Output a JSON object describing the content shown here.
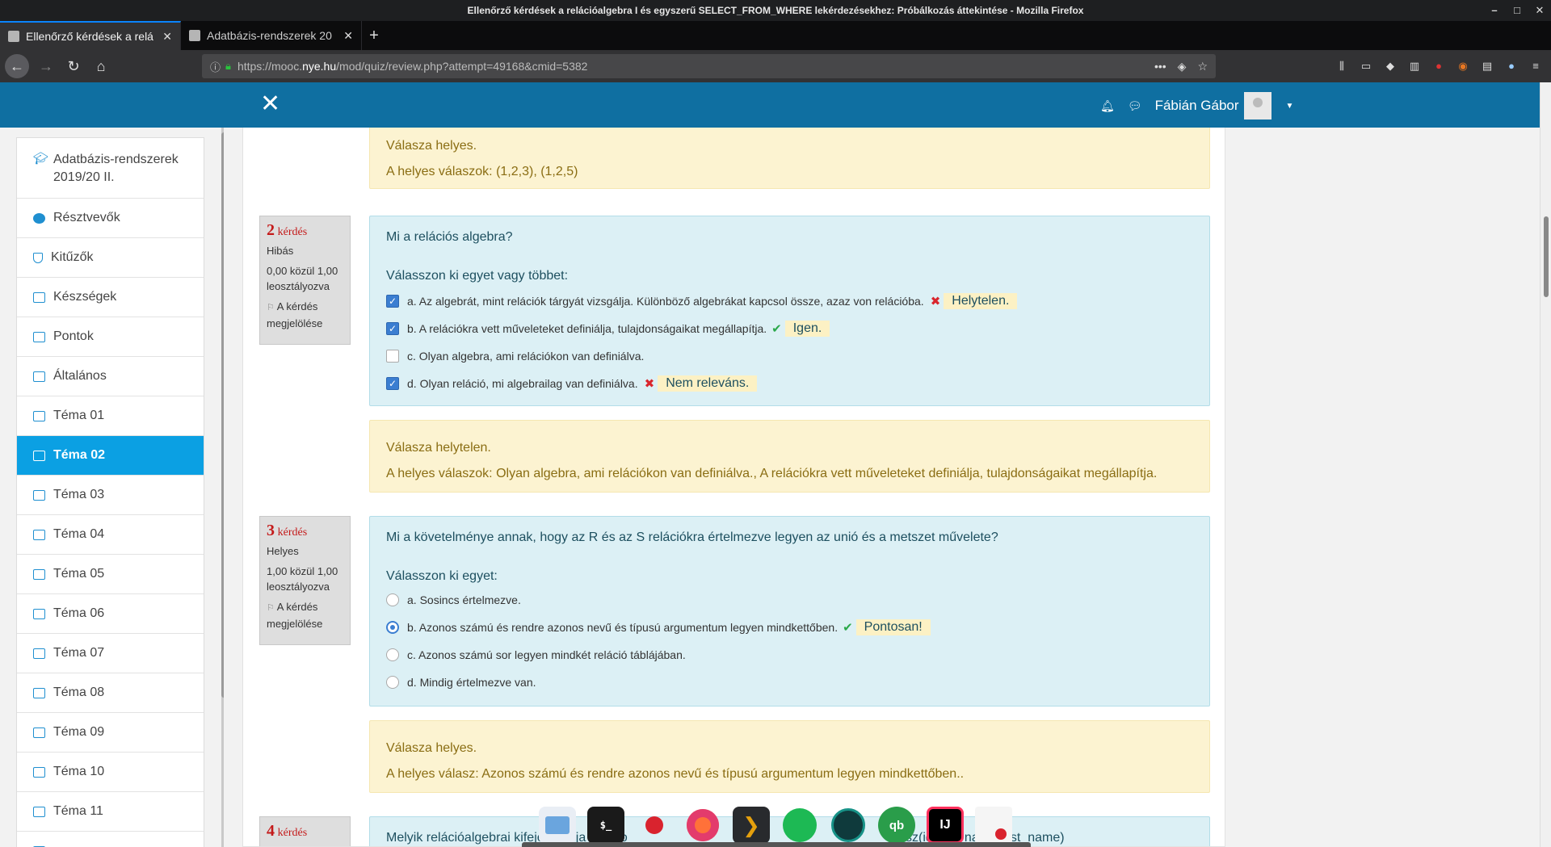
{
  "window": {
    "title": "Ellenőrző kérdések a relációalgebra I és egyszerű SELECT_FROM_WHERE lekérdezésekhez: Próbálkozás áttekintése - Mozilla Firefox"
  },
  "tabs": [
    {
      "label": "Ellenőrző kérdések a relá"
    },
    {
      "label": "Adatbázis-rendszerek 20"
    }
  ],
  "urlbar": {
    "prefix": "https://mooc.",
    "host": "nye.hu",
    "path": "/mod/quiz/review.php?attempt=49168&cmid=5382"
  },
  "moodle_header": {
    "user_name": "Fábián Gábor"
  },
  "sidebar": {
    "items": [
      {
        "label": "Adatbázis-rendszerek 2019/20 II.",
        "icon": "graduation-cap-icon"
      },
      {
        "label": "Résztvevők",
        "icon": "users-icon"
      },
      {
        "label": "Kitűzők",
        "icon": "shield-icon"
      },
      {
        "label": "Készségek",
        "icon": "check-square-icon"
      },
      {
        "label": "Pontok",
        "icon": "table-icon"
      },
      {
        "label": "Általános",
        "icon": "folder-icon"
      },
      {
        "label": "Téma 01",
        "icon": "folder-icon"
      },
      {
        "label": "Téma 02",
        "icon": "folder-icon",
        "active": true
      },
      {
        "label": "Téma 03",
        "icon": "folder-icon"
      },
      {
        "label": "Téma 04",
        "icon": "folder-icon"
      },
      {
        "label": "Téma 05",
        "icon": "folder-icon"
      },
      {
        "label": "Téma 06",
        "icon": "folder-icon"
      },
      {
        "label": "Téma 07",
        "icon": "folder-icon"
      },
      {
        "label": "Téma 08",
        "icon": "folder-icon"
      },
      {
        "label": "Téma 09",
        "icon": "folder-icon"
      },
      {
        "label": "Téma 10",
        "icon": "folder-icon"
      },
      {
        "label": "Téma 11",
        "icon": "folder-icon"
      }
    ]
  },
  "q1_feedback": {
    "status": "Válasza helyes.",
    "right_answer": "A helyes válaszok: (1,2,3), (1,2,5)"
  },
  "q2": {
    "number": "2",
    "word": "kérdés",
    "state": "Hibás",
    "grade": "0,00 közül 1,00 leosztályozva",
    "flag": "A kérdés megjelölése",
    "text": "Mi a relációs algebra?",
    "prompt": "Válasszon ki egyet vagy többet:",
    "options": [
      {
        "text": "a. Az algebrát, mint relációk tárgyát vizsgálja. Különböző algebrákat kapcsol össze, azaz von relációba.",
        "feedback": "Helytelen."
      },
      {
        "text": "b. A relációkra vett műveleteket definiálja, tulajdonságaikat megállapítja.",
        "feedback": "Igen."
      },
      {
        "text": "c. Olyan algebra, ami relációkon van definiálva."
      },
      {
        "text": "d. Olyan reláció, mi algebrailag van definiálva.",
        "feedback": "Nem releváns."
      }
    ],
    "status": "Válasza helytelen.",
    "right_answer": "A helyes válaszok: Olyan algebra, ami relációkon van definiálva., A relációkra vett műveleteket definiálja, tulajdonságaikat megállapítja."
  },
  "q3": {
    "number": "3",
    "word": "kérdés",
    "state": "Helyes",
    "grade": "1,00 közül 1,00 leosztályozva",
    "flag": "A kérdés megjelölése",
    "text": "Mi a követelménye annak, hogy az R és az S relációkra értelmezve legyen az unió és a metszet művelete?",
    "prompt": "Válasszon ki egyet:",
    "options": [
      {
        "text": "a. Sosincs értelmezve."
      },
      {
        "text": "b. Azonos számú és rendre azonos nevű és típusú argumentum legyen mindkettőben.",
        "feedback": "Pontosan!"
      },
      {
        "text": "c. Azonos számú sor legyen mindkét reláció táblájában."
      },
      {
        "text": "d. Mindig értelmezve van."
      }
    ],
    "status": "Válasza helyes.",
    "right_answer": "A helyes válasz: Azonos számú és rendre azonos nevű és típusú argumentum legyen mindkettőben.."
  },
  "q4": {
    "number": "4",
    "word": "kérdés",
    "text_visible": "Melyik relációalgebrai kifejezés írja le a Jo",
    "text_tail": "ursz(id,first_name,last_name)"
  },
  "dock": {
    "icons": [
      "files-icon",
      "terminal-icon",
      "cherry-icon",
      "firefox-icon",
      "plex-icon",
      "spotify-icon",
      "gitkraken-icon",
      "qbittorrent-icon",
      "intellij-icon",
      "text-editor-icon"
    ],
    "terminal_glyph": "$_",
    "intellij_glyph": "IJ",
    "qbittorrent_glyph": "qb"
  },
  "colors": {
    "moodle_header": "#0f6fa1",
    "active_item": "#0ba0e3",
    "formulation_bg": "#dcf0f5",
    "feedback_bg": "#fcf3d1",
    "incorrect": "#c41a1a"
  }
}
